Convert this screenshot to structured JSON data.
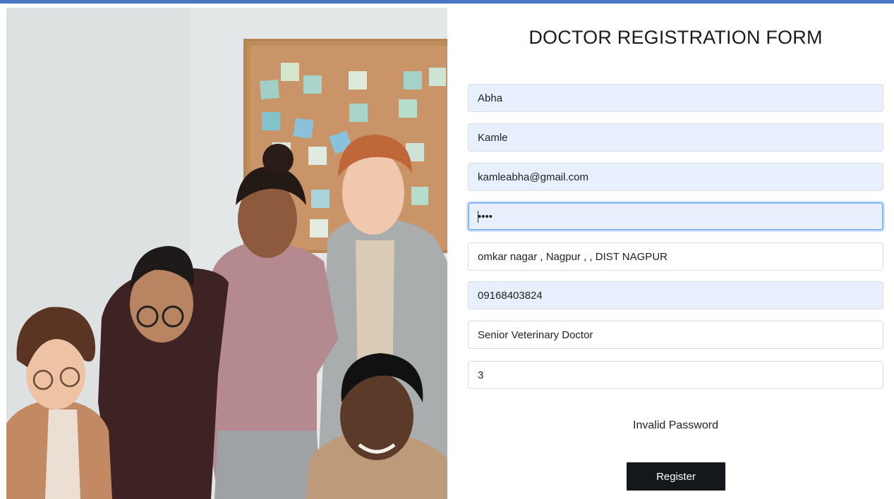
{
  "header": {
    "accent_color": "#4a76c4"
  },
  "hero_image": {
    "icon": "group-of-colleagues-photo"
  },
  "form": {
    "title": "DOCTOR REGISTRATION FORM",
    "fields": {
      "first_name": "Abha",
      "last_name": "Kamle",
      "email": "kamleabha@gmail.com",
      "password": "••••",
      "address": "omkar nagar , Nagpur , , DIST NAGPUR",
      "phone": "09168403824",
      "designation": "Senior Veterinary Doctor",
      "experience": "3"
    },
    "error_message": "Invalid Password",
    "submit_label": "Register",
    "colors": {
      "autofill_background": "#e8f0fe",
      "focus_border": "#86b7fe",
      "button_background": "#14181c"
    }
  }
}
